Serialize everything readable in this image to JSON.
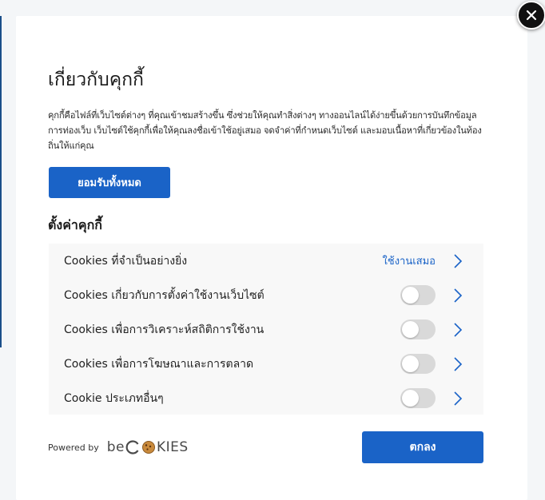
{
  "dialog": {
    "title": "เกี่ยวกับคุกกี้",
    "description": "คุกกี้คือไฟล์ที่เว็บไซต์ต่างๆ ที่คุณเข้าชมสร้างขึ้น ซึ่งช่วยให้คุณทำสิ่งต่างๆ ทางออนไลน์ได้ง่ายขึ้นด้วยการบันทึกข้อมูลการท่องเว็บ เว็บไซต์ใช้คุกกี้เพื่อให้คุณลงชื่อเข้าใช้อยู่เสมอ จดจำค่าที่กำหนดเว็บไซต์ และมอบเนื้อหาที่เกี่ยวข้องในท้องถิ่นให้แก่คุณ",
    "accept_all_label": "ยอมรับทั้งหมด",
    "settings_title": "ตั้งค่าคุกกี้",
    "close_icon": "close-icon"
  },
  "categories": [
    {
      "label": "Cookies ที่จำเป็นอย่างยิ่ง",
      "status": "ใช้งานเสมอ",
      "enabled": true,
      "always_on": true
    },
    {
      "label": "Cookies เกี่ยวกับการตั้งค่าใช้งานเว็บไซต์",
      "enabled": false,
      "always_on": false
    },
    {
      "label": "Cookies เพื่อการวิเคราะห์สถิติการใช้งาน",
      "enabled": false,
      "always_on": false
    },
    {
      "label": "Cookies เพื่อการโฆษณาและการตลาด",
      "enabled": false,
      "always_on": false
    },
    {
      "label": "Cookie ประเภทอื่นๆ",
      "enabled": false,
      "always_on": false
    }
  ],
  "footer": {
    "powered_by": "Powered by",
    "brand_prefix": "be",
    "brand_suffix": "KIES",
    "ok_label": "ตกลง"
  },
  "colors": {
    "accent": "#1a63c7",
    "toggle_off": "#d9d9d9",
    "row_background": "#f8f8f8"
  }
}
